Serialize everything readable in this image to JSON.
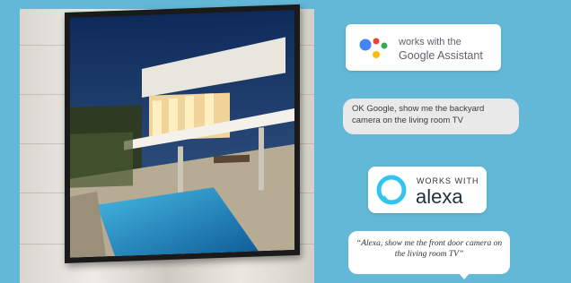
{
  "google_assistant": {
    "line1": "works with the",
    "line2": "Google Assistant",
    "dot_colors": [
      "#4285f4",
      "#ea4335",
      "#fbbc05",
      "#34a853"
    ]
  },
  "google_bubble": {
    "text": "OK Google, show me the backyard camera on the living room TV"
  },
  "alexa": {
    "works_with": "WORKS WITH",
    "wordmark": "alexa",
    "ring_color": "#31c4f3"
  },
  "alexa_bubble": {
    "text": "“Alexa, show me the front door camera on the living room TV”"
  },
  "colors": {
    "background": "#63b8d7",
    "bubble_gray": "#e9e9e9"
  }
}
